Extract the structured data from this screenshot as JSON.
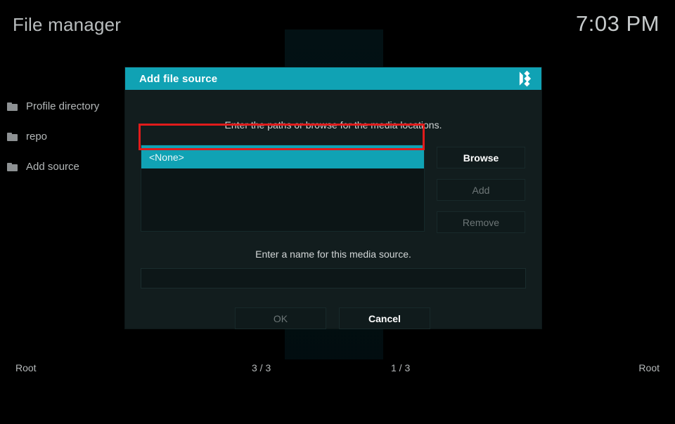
{
  "app": {
    "page_title": "File manager",
    "clock": "7:03 PM"
  },
  "left_pane": {
    "items": [
      {
        "label": "Profile directory",
        "icon": "folder-icon"
      },
      {
        "label": "repo",
        "icon": "folder-icon"
      },
      {
        "label": "Add source",
        "icon": "folder-icon"
      }
    ]
  },
  "status_bar": {
    "left_label": "Root",
    "left_count": "3 / 3",
    "right_count": "1 / 3",
    "right_label": "Root"
  },
  "dialog": {
    "title": "Add file source",
    "logo_icon": "kodi-logo-icon",
    "hint_paths": "Enter the paths or browse for the media locations.",
    "hint_name": "Enter a name for this media source.",
    "path_list": {
      "selected_value": "<None>",
      "items": [
        "<None>"
      ]
    },
    "name_value": "",
    "name_placeholder": "",
    "buttons": {
      "browse": "Browse",
      "add": "Add",
      "remove": "Remove",
      "ok": "OK",
      "cancel": "Cancel"
    },
    "disabled_buttons": [
      "Add",
      "Remove",
      "OK"
    ]
  },
  "colors": {
    "accent_teal": "#10a2b4",
    "dialog_bg": "#121d1e",
    "annotation_red": "#e01b1b",
    "page_bg": "#000000",
    "text_primary": "#d2d6d7",
    "text_disabled": "#6d7677"
  }
}
